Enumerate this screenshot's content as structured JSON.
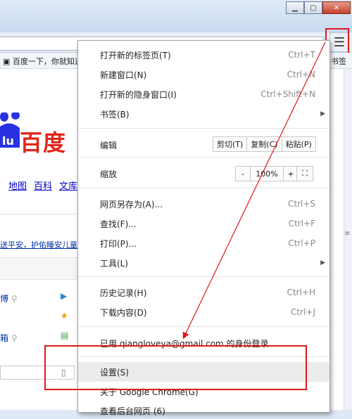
{
  "window": {
    "minimize_icon": "minimize-icon",
    "maximize_icon": "maximize-icon",
    "close_icon": "close-icon"
  },
  "toolbar": {
    "menu_icon": "hamburger-menu-icon",
    "menu_glyph": "☰"
  },
  "bookmarks": {
    "item_label": "百度一下，你就知道",
    "right_label": "书签"
  },
  "page": {
    "logo_text": "百度",
    "nav_links": [
      "地图",
      "百科",
      "文库"
    ],
    "news_text": "送平安，护佑睡安儿童",
    "link1": "博",
    "link2": "箱"
  },
  "menu": {
    "items": [
      {
        "label": "打开新的标签页(T)",
        "shortcut": "Ctrl+T"
      },
      {
        "label": "新建窗口(N)",
        "shortcut": "Ctrl+N"
      },
      {
        "label": "打开新的隐身窗口(I)",
        "shortcut": "Ctrl+Shift+N"
      },
      {
        "label": "书签(B)",
        "shortcut": ""
      }
    ],
    "edit": {
      "label": "编辑",
      "cut": "剪切(T)",
      "copy": "复制(C)",
      "paste": "粘贴(P)"
    },
    "zoom": {
      "label": "缩放",
      "minus": "-",
      "value": "100%",
      "plus": "+",
      "fullscreen_glyph": "⛶"
    },
    "items2": [
      {
        "label": "网页另存为(A)...",
        "shortcut": "Ctrl+S"
      },
      {
        "label": "查找(F)...",
        "shortcut": "Ctrl+F"
      },
      {
        "label": "打印(P)...",
        "shortcut": "Ctrl+P"
      },
      {
        "label": "工具(L)",
        "shortcut": ""
      }
    ],
    "items3": [
      {
        "label": "历史记录(H)",
        "shortcut": "Ctrl+H"
      },
      {
        "label": "下载内容(D)",
        "shortcut": "Ctrl+J"
      }
    ],
    "signin": "已用 qiangloveya@gmail.com 的身份登录...",
    "settings": "设置(S)",
    "about": "关于 Google Chrome(G)",
    "last": "查看后台网页 (6)"
  },
  "colors": {
    "annotation_red": "#e01818",
    "baidu_red": "#e1261c",
    "baidu_blue": "#2932e1"
  }
}
